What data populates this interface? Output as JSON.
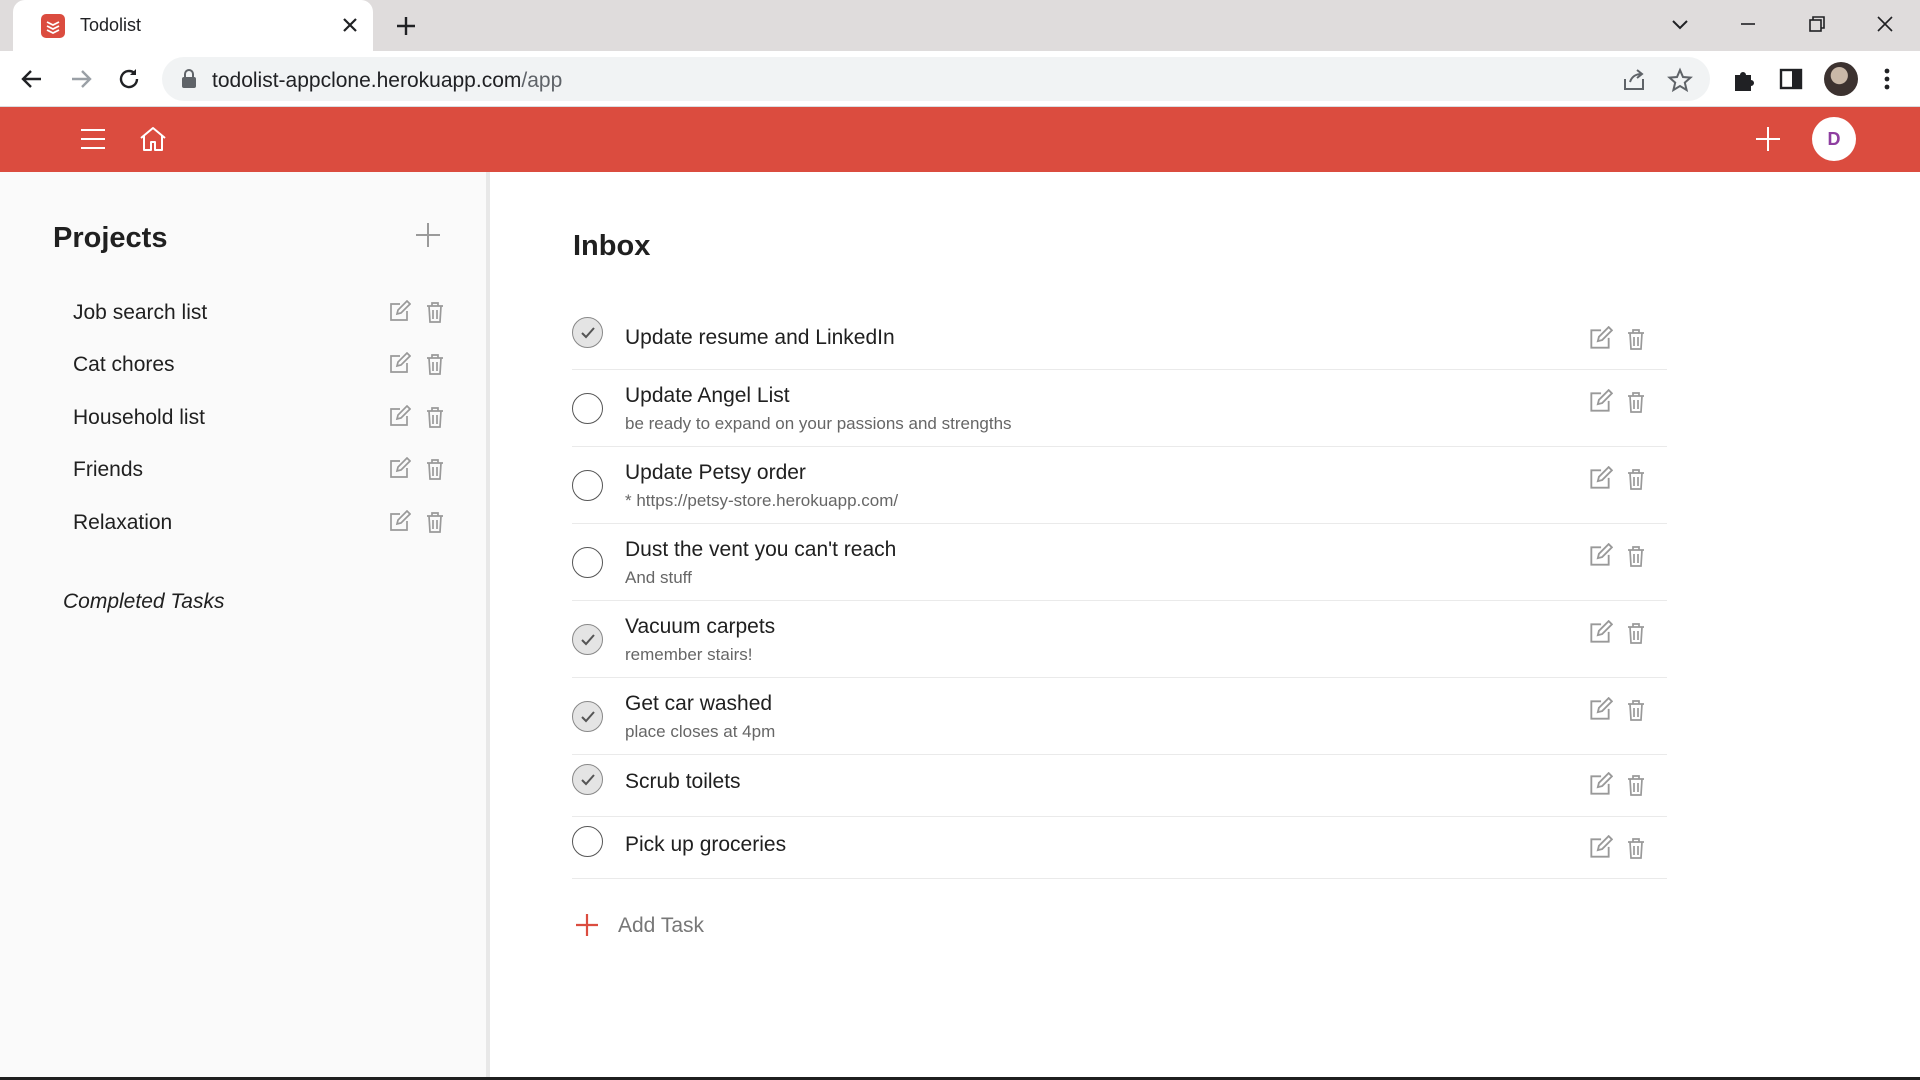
{
  "browser": {
    "tab_title": "Todolist",
    "url_host": "todolist-appclone.herokuapp.com",
    "url_path": "/app"
  },
  "header": {
    "avatar_initial": "D",
    "accent_color": "#db4c3f"
  },
  "sidebar": {
    "title": "Projects",
    "projects": [
      {
        "label": "Job search list"
      },
      {
        "label": "Cat chores"
      },
      {
        "label": "Household list"
      },
      {
        "label": "Friends"
      },
      {
        "label": "Relaxation"
      }
    ],
    "completed_label": "Completed Tasks"
  },
  "main": {
    "title": "Inbox",
    "tasks": [
      {
        "name": "Update resume and LinkedIn",
        "description": "",
        "completed": true
      },
      {
        "name": "Update Angel List",
        "description": "be ready to expand on your passions and strengths",
        "completed": false
      },
      {
        "name": "Update Petsy order",
        "description": "* https://petsy-store.herokuapp.com/",
        "completed": false
      },
      {
        "name": "Dust the vent you can't reach",
        "description": "And stuff",
        "completed": false
      },
      {
        "name": "Vacuum carpets",
        "description": "remember stairs!",
        "completed": true
      },
      {
        "name": "Get car washed",
        "description": "place closes at 4pm",
        "completed": true
      },
      {
        "name": "Scrub toilets",
        "description": "",
        "completed": true
      },
      {
        "name": "Pick up groceries",
        "description": "",
        "completed": false
      }
    ],
    "add_task_label": "Add Task"
  }
}
